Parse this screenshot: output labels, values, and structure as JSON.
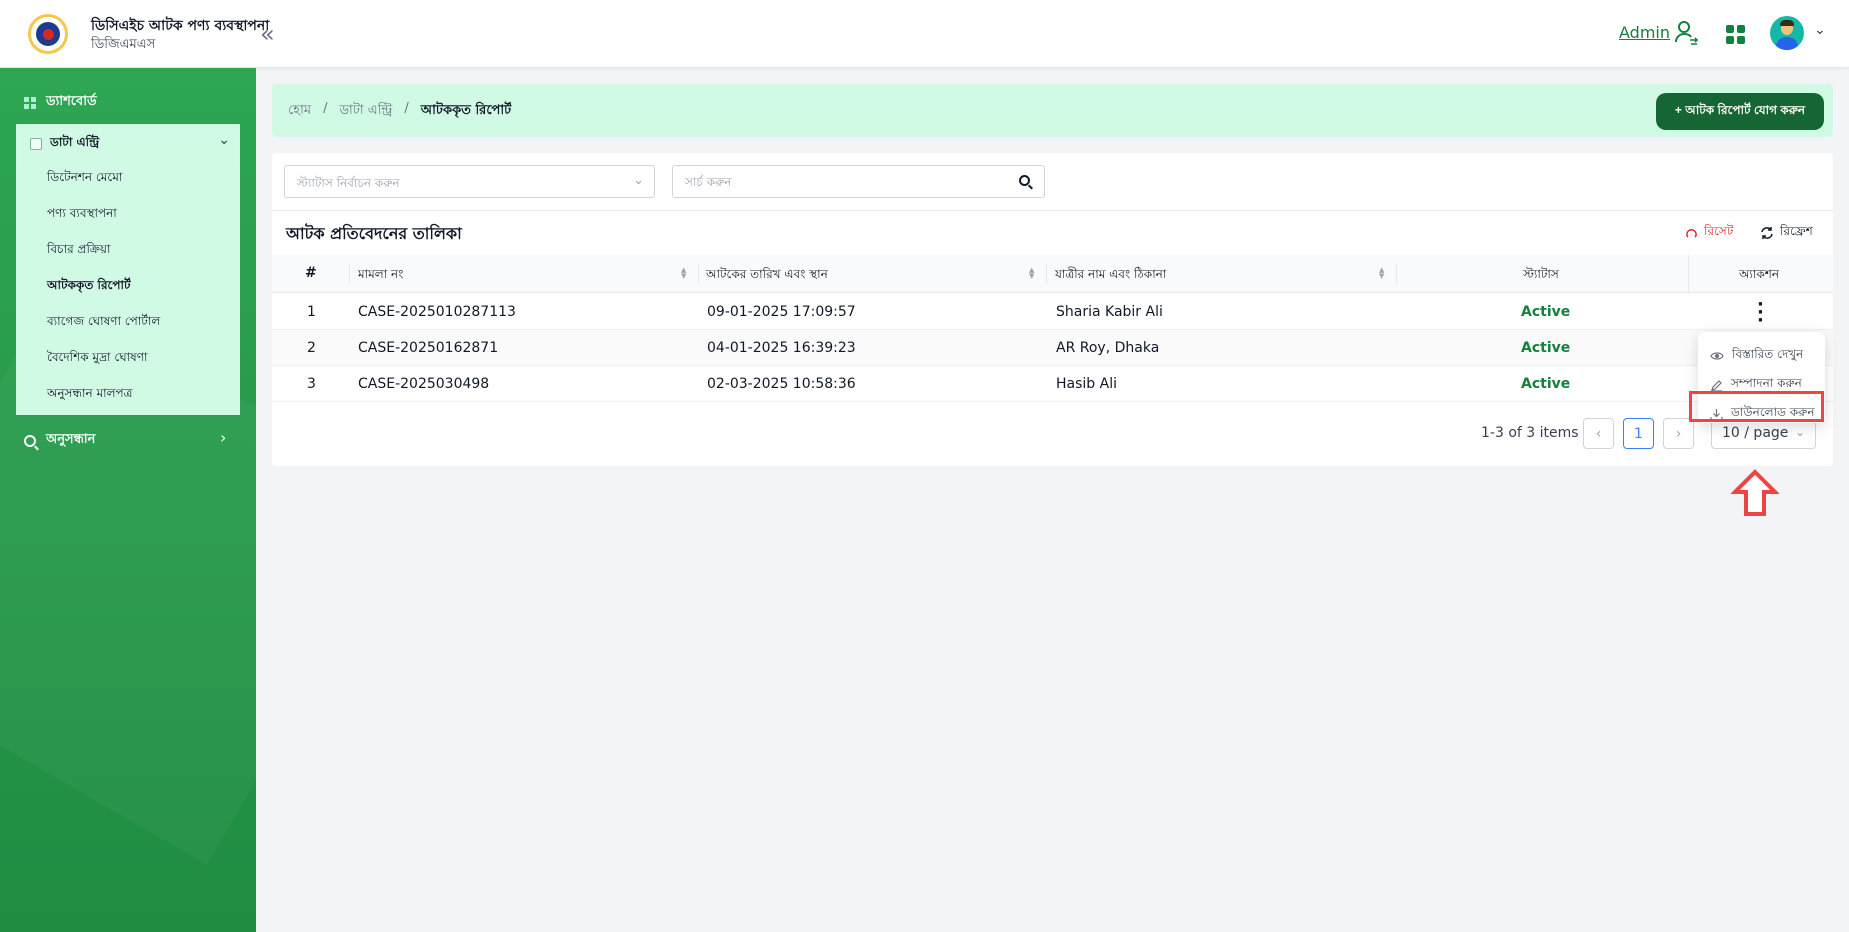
{
  "header": {
    "app_title": "ডিসিএইচ আটক পণ্য ব্যবস্থাপনা",
    "app_subtitle": "ডিজিএমএস",
    "user": "Admin"
  },
  "sidebar": {
    "dashboard": "ড্যাশবোর্ড",
    "data_entry": "ডাটা এন্ট্রি",
    "items": [
      {
        "label": "ডিটেনশন মেমো"
      },
      {
        "label": "পণ্য ব্যবস্থাপনা"
      },
      {
        "label": "বিচার প্রক্রিয়া"
      },
      {
        "label": "আটককৃত রিপোর্ট"
      },
      {
        "label": "ব্যাগেজ ঘোষণা পোর্টাল"
      },
      {
        "label": "বৈদেশিক মুদ্রা ঘোষণা"
      },
      {
        "label": "অনুসন্ধান মালপত্র"
      }
    ],
    "search_nav": "অনুসন্ধান"
  },
  "breadcrumb": [
    "হোম",
    "/",
    "ডাটা এন্ট্রি",
    "/",
    "আটককৃত রিপোর্ট"
  ],
  "add_button": "+ আটক রিপোর্ট যোগ করুন",
  "filters": {
    "status_placeholder": "স্ট্যাটাস নির্বাচন করুন",
    "search_placeholder": "সার্চ করুন"
  },
  "table": {
    "title": "আটক প্রতিবেদনের তালিকা",
    "reset": "রিসেট",
    "refresh": "রিফ্রেশ",
    "columns": [
      "#",
      "মামলা নং",
      "আটকের তারিখ এবং স্থান",
      "যাত্রীর নাম এবং ঠিকানা",
      "স্ট্যাটাস",
      "অ্যাকশন"
    ],
    "rows": [
      {
        "no": "1",
        "case": "CASE-2025010287113",
        "date": "09-01-2025 17:09:57",
        "name": "Sharia Kabir Ali",
        "status": "Active"
      },
      {
        "no": "2",
        "case": "CASE-20250162871",
        "date": "04-01-2025 16:39:23",
        "name": "AR Roy, Dhaka",
        "status": "Active"
      },
      {
        "no": "3",
        "case": "CASE-2025030498",
        "date": "02-03-2025 10:58:36",
        "name": "Hasib Ali",
        "status": "Active"
      }
    ]
  },
  "action_menu": [
    "বিস্তারিত দেখুন",
    "সম্পাদনা করুন",
    "ডাউনলোড করুন"
  ],
  "pagination": {
    "info": "1-3 of 3 items",
    "page": "1",
    "size": "10 / page"
  },
  "colors": {
    "brand": "#15803d",
    "highlight": "#ef4444"
  }
}
